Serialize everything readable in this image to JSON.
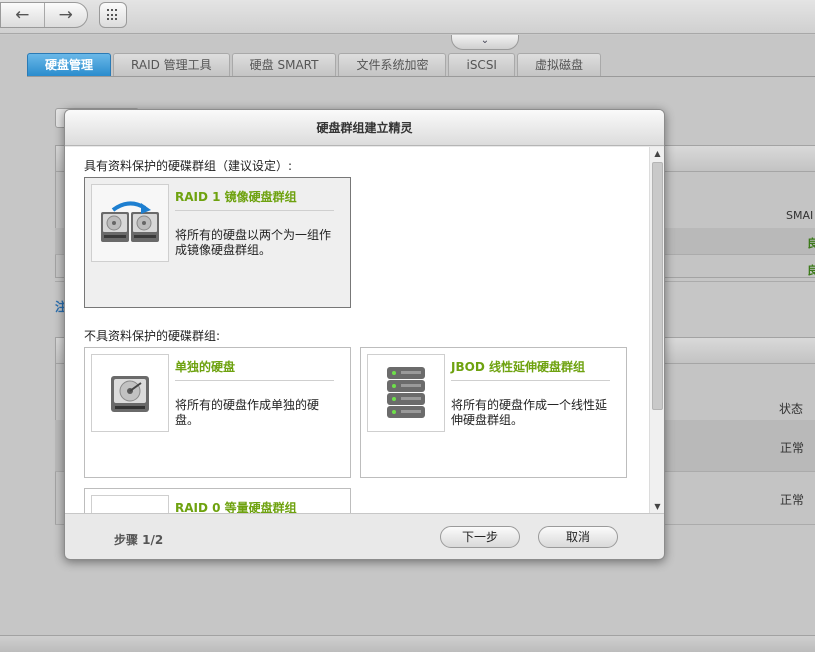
{
  "toolbar": {
    "back_icon": "back-arrow-icon",
    "forward_icon": "forward-arrow-icon",
    "apps_icon": "grid-icon",
    "collapse_icon": "chevron-down-icon"
  },
  "tabs": [
    {
      "label": "硬盘管理",
      "active": true
    },
    {
      "label": "RAID 管理工具",
      "active": false
    },
    {
      "label": "硬盘 SMART",
      "active": false
    },
    {
      "label": "文件系统加密",
      "active": false
    },
    {
      "label": "iSCSI",
      "active": false
    },
    {
      "label": "虚拟磁盘",
      "active": false
    }
  ],
  "background": {
    "smart_header": "SMAI",
    "green_marks": [
      "良",
      "良"
    ],
    "hint_fragment": "注",
    "status_header": "状态",
    "status_values": [
      "正常",
      "正常"
    ]
  },
  "dialog": {
    "title": "硬盘群组建立精灵",
    "section_protected": "具有资料保护的硬碟群组（建议设定）:",
    "section_unprotected": "不具资料保护的硬碟群组:",
    "cards": {
      "raid1": {
        "title": "RAID 1 镜像硬盘群组",
        "desc": "将所有的硬盘以两个为一组作成镜像硬盘群组。",
        "icon": "mirror-disks-icon",
        "selected": true
      },
      "single": {
        "title": "单独的硬盘",
        "desc": "将所有的硬盘作成单独的硬盘。",
        "icon": "hard-disk-icon"
      },
      "jbod": {
        "title": "JBOD 线性延伸硬盘群组",
        "desc": "将所有的硬盘作成一个线性延伸硬盘群组。",
        "icon": "disk-stack-icon"
      },
      "raid0": {
        "title": "RAID 0 等量硬盘群组",
        "icon": "striped-disks-icon"
      }
    },
    "step": "步骤 1/2",
    "next_label": "下一步",
    "cancel_label": "取消",
    "accent_color": "#6ea20f"
  }
}
